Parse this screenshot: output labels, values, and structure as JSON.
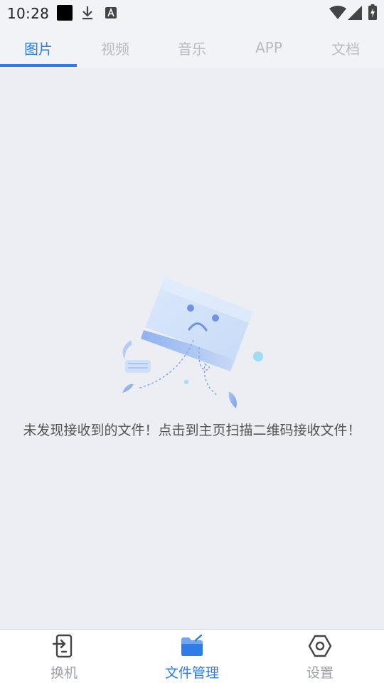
{
  "status_bar": {
    "time": "10:28",
    "icons": [
      "notification-block-icon",
      "download-icon",
      "text-a-icon",
      "wifi-icon",
      "signal-icon",
      "battery-charging-icon"
    ]
  },
  "tabs": [
    {
      "label": "图片",
      "active": true
    },
    {
      "label": "视频",
      "active": false
    },
    {
      "label": "音乐",
      "active": false
    },
    {
      "label": "APP",
      "active": false
    },
    {
      "label": "文档",
      "active": false
    }
  ],
  "empty_state": {
    "illustration": "sad-folder-illustration",
    "message": "未发现接收到的文件！点击到主页扫描二维码接收文件！"
  },
  "bottom_nav": {
    "items": [
      {
        "label": "换机",
        "icon": "phone-transfer-icon",
        "active": false
      },
      {
        "label": "文件管理",
        "icon": "folder-icon",
        "active": true
      },
      {
        "label": "设置",
        "icon": "settings-hexagon-icon",
        "active": false
      }
    ]
  },
  "colors": {
    "accent": "#2f7ce8",
    "background": "#eceef3",
    "inactive_tab": "#b8bbc3",
    "inactive_nav": "#9a9ea6"
  }
}
